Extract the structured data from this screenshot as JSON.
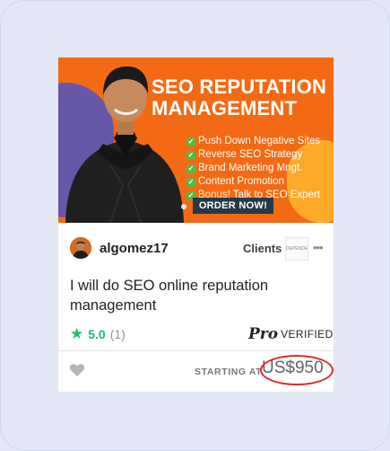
{
  "colors": {
    "page_bg": "#e4e8f6",
    "hero_orange": "#f46a14",
    "accent_green": "#1dbf73",
    "cta_dark": "#233b47",
    "highlight_circle": "#e0262a"
  },
  "gig": {
    "banner": {
      "headline": "SEO REPUTATION MANAGEMENT",
      "bullets": [
        "Push Down Negative Sites",
        "Reverse SEO Strategy",
        "Brand Marketing Mngt.",
        "Content Promotion"
      ],
      "bonus_label": "Bonus!",
      "bonus_text": " Talk to SEO Expert",
      "cta": "ORDER NOW!",
      "carousel_dots": 3
    },
    "seller": {
      "username": "algomez17",
      "avatar_icon": "seller-avatar"
    },
    "clients_label": "Clients",
    "client_logo_text": "DEPENDENT",
    "more_icon": "more-dots-icon",
    "title": "I will do SEO online reputation management",
    "rating": {
      "value": "5.0",
      "count": "(1)"
    },
    "pro": {
      "mark": "Pro",
      "verified": "VERIFIED"
    },
    "favorite_icon": "heart-icon",
    "starting_at": "STARTING AT",
    "price": "US$950"
  }
}
